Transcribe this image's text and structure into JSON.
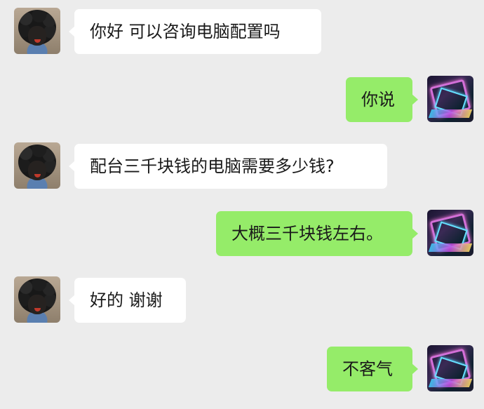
{
  "conversation": {
    "messages": [
      {
        "side": "left",
        "avatar": "user-avatar-dark-hair",
        "text": "你好 可以咨询电脑配置吗"
      },
      {
        "side": "right",
        "avatar": "self-avatar-neon",
        "text": "你说"
      },
      {
        "side": "left",
        "avatar": "user-avatar-dark-hair",
        "text": "配台三千块钱的电脑需要多少钱?"
      },
      {
        "side": "right",
        "avatar": "self-avatar-neon",
        "text": "大概三千块钱左右。"
      },
      {
        "side": "left",
        "avatar": "user-avatar-dark-hair",
        "text": "好的 谢谢"
      },
      {
        "side": "right",
        "avatar": "self-avatar-neon",
        "text": "不客气"
      }
    ]
  },
  "colors": {
    "background": "#ececec",
    "incoming_bubble": "#ffffff",
    "outgoing_bubble": "#95ec69",
    "text": "#1a1a1a"
  }
}
